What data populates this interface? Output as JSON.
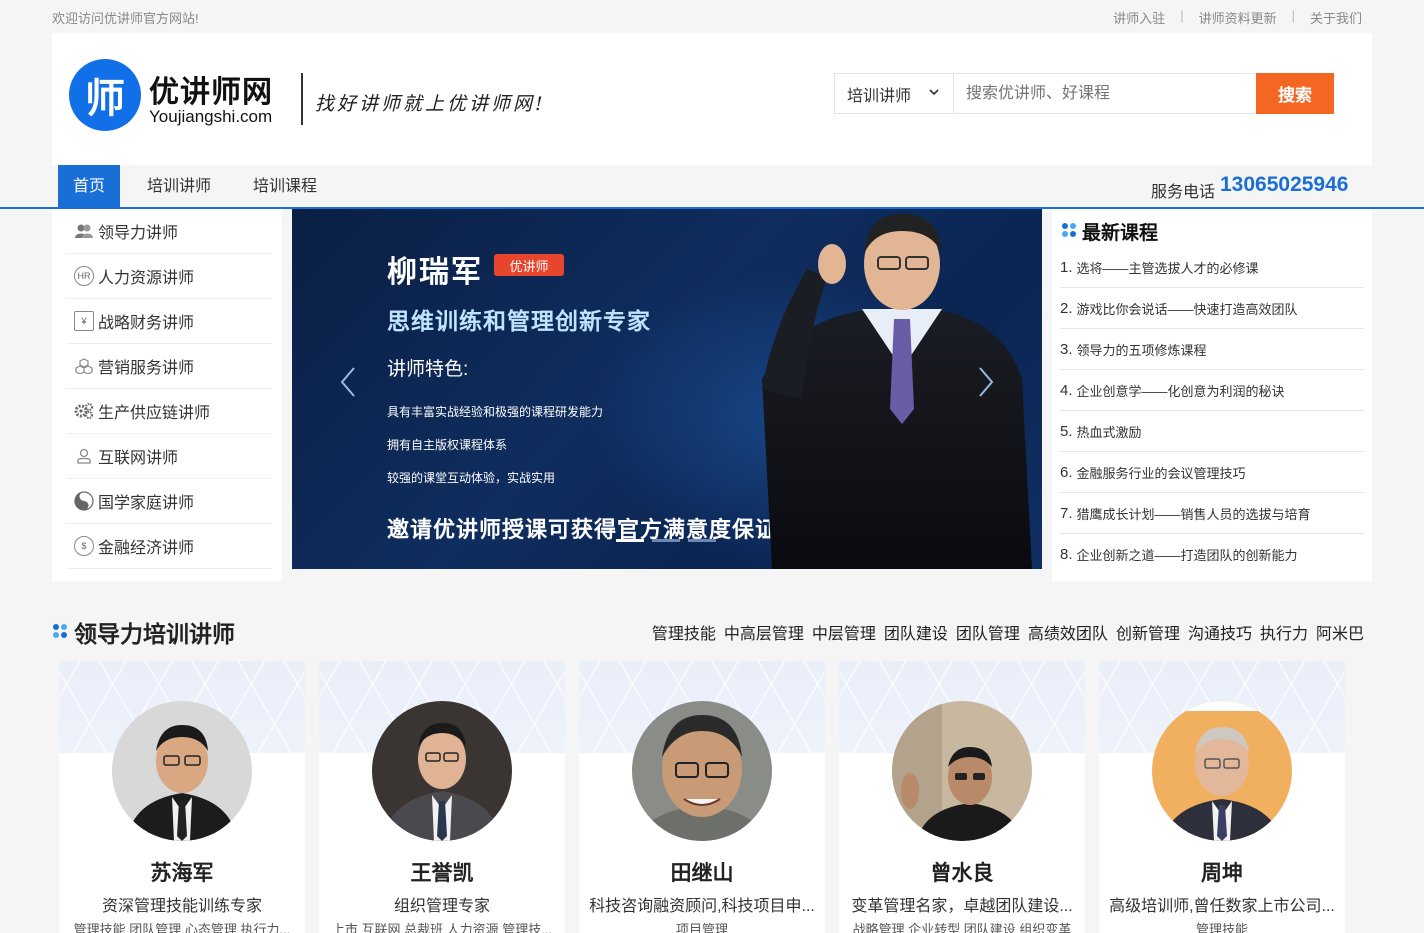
{
  "topbar": {
    "welcome": "欢迎访问优讲师官方网站!",
    "links": [
      "讲师入驻",
      "讲师资料更新",
      "关于我们"
    ]
  },
  "header": {
    "logo_glyph": "师",
    "logo_cn": "优讲师网",
    "logo_en": "Youjiangshi.com",
    "slogan": "找好讲师就上优讲师网!",
    "search": {
      "category": "培训讲师",
      "placeholder": "搜索优讲师、好课程",
      "button": "搜索"
    }
  },
  "nav": {
    "items": [
      "首页",
      "培训讲师",
      "培训课程"
    ],
    "active_index": 0,
    "phone_label": "服务电话",
    "phone": "13065025946"
  },
  "sidebar": {
    "items": [
      {
        "label": "领导力讲师",
        "icon": "people-icon"
      },
      {
        "label": "人力资源讲师",
        "icon": "hr-icon"
      },
      {
        "label": "战略财务讲师",
        "icon": "finance-doc-icon"
      },
      {
        "label": "营销服务讲师",
        "icon": "cubes-icon"
      },
      {
        "label": "生产供应链讲师",
        "icon": "gears-icon"
      },
      {
        "label": "互联网讲师",
        "icon": "user-icon"
      },
      {
        "label": "国学家庭讲师",
        "icon": "yin-yang-icon"
      },
      {
        "label": "金融经济讲师",
        "icon": "money-icon"
      }
    ]
  },
  "banner": {
    "name": "柳瑞军",
    "tag": "优讲师",
    "title": "思维训练和管理创新专家",
    "feature_heading": "讲师特色:",
    "features": [
      "具有丰富实战经验和极强的课程研发能力",
      "拥有自主版权课程体系",
      "较强的课堂互动体验，实战实用"
    ],
    "slogan": "邀请优讲师授课可获得官方满意度保证!",
    "active_slide": 0,
    "slide_count": 3
  },
  "latest": {
    "title": "最新课程",
    "items": [
      "选将——主管选拔人才的必修课",
      "游戏比你会说话——快速打造高效团队",
      "领导力的五项修炼课程",
      "企业创意学——化创意为利润的秘诀",
      "热血式激励",
      "金融服务行业的会议管理技巧",
      "猎鹰成长计划——销售人员的选拔与培育",
      "企业创新之道——打造团队的创新能力"
    ]
  },
  "section": {
    "title": "领导力培训讲师",
    "tags": [
      "管理技能",
      "中高层管理",
      "中层管理",
      "团队建设",
      "团队管理",
      "高绩效团队",
      "创新管理",
      "沟通技巧",
      "执行力",
      "阿米巴"
    ]
  },
  "cards": [
    {
      "name": "苏海军",
      "desc": "资深管理技能训练专家",
      "tags": "管理技能 团队管理 心态管理 执行力..."
    },
    {
      "name": "王誉凯",
      "desc": "组织管理专家",
      "tags": "上市 互联网 总裁班 人力资源 管理技..."
    },
    {
      "name": "田继山",
      "desc": "科技咨询融资顾问,科技项目申...",
      "tags": "项目管理"
    },
    {
      "name": "曾水良",
      "desc": "变革管理名家，卓越团队建设...",
      "tags": "战略管理 企业转型 团队建设 组织变革"
    },
    {
      "name": "周坤",
      "desc": "高级培训师,曾任数家上市公司...",
      "tags": "管理技能"
    }
  ],
  "colors": {
    "brand_blue": "#1a6fd6",
    "search_orange": "#f46722"
  }
}
